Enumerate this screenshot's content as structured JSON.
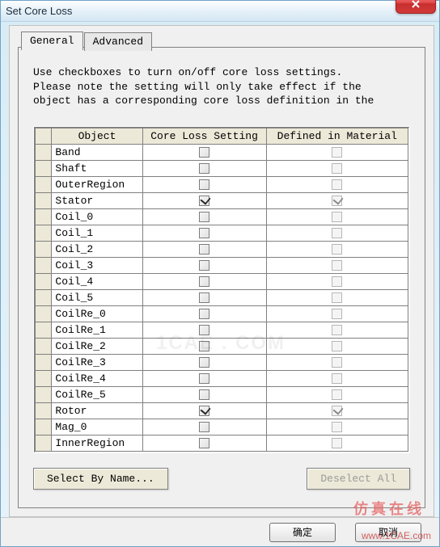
{
  "window": {
    "title": "Set Core Loss"
  },
  "tabs": {
    "general": "General",
    "advanced": "Advanced"
  },
  "description": "Use checkboxes to turn on/off core loss settings.\nPlease note the setting will only take effect if the\nobject has a corresponding core loss definition in the",
  "columns": {
    "object": "Object",
    "setting": "Core Loss Setting",
    "defined": "Defined in Material"
  },
  "rows": [
    {
      "object": "Band",
      "setting": false,
      "defined": false,
      "defined_enabled": false
    },
    {
      "object": "Shaft",
      "setting": false,
      "defined": false,
      "defined_enabled": false
    },
    {
      "object": "OuterRegion",
      "setting": false,
      "defined": false,
      "defined_enabled": false
    },
    {
      "object": "Stator",
      "setting": true,
      "defined": true,
      "defined_enabled": false
    },
    {
      "object": "Coil_0",
      "setting": false,
      "defined": false,
      "defined_enabled": false
    },
    {
      "object": "Coil_1",
      "setting": false,
      "defined": false,
      "defined_enabled": false
    },
    {
      "object": "Coil_2",
      "setting": false,
      "defined": false,
      "defined_enabled": false
    },
    {
      "object": "Coil_3",
      "setting": false,
      "defined": false,
      "defined_enabled": false
    },
    {
      "object": "Coil_4",
      "setting": false,
      "defined": false,
      "defined_enabled": false
    },
    {
      "object": "Coil_5",
      "setting": false,
      "defined": false,
      "defined_enabled": false
    },
    {
      "object": "CoilRe_0",
      "setting": false,
      "defined": false,
      "defined_enabled": false
    },
    {
      "object": "CoilRe_1",
      "setting": false,
      "defined": false,
      "defined_enabled": false
    },
    {
      "object": "CoilRe_2",
      "setting": false,
      "defined": false,
      "defined_enabled": false
    },
    {
      "object": "CoilRe_3",
      "setting": false,
      "defined": false,
      "defined_enabled": false
    },
    {
      "object": "CoilRe_4",
      "setting": false,
      "defined": false,
      "defined_enabled": false
    },
    {
      "object": "CoilRe_5",
      "setting": false,
      "defined": false,
      "defined_enabled": false
    },
    {
      "object": "Rotor",
      "setting": true,
      "defined": true,
      "defined_enabled": false
    },
    {
      "object": "Mag_0",
      "setting": false,
      "defined": false,
      "defined_enabled": false
    },
    {
      "object": "InnerRegion",
      "setting": false,
      "defined": false,
      "defined_enabled": false
    }
  ],
  "buttons": {
    "select_by_name": "Select By Name...",
    "deselect_all": "Deselect All",
    "ok": "确定",
    "cancel": "取消"
  },
  "watermark": {
    "cn": "仿真在线",
    "url": "www.1CAE.com",
    "mid": "1CAE . COM"
  }
}
